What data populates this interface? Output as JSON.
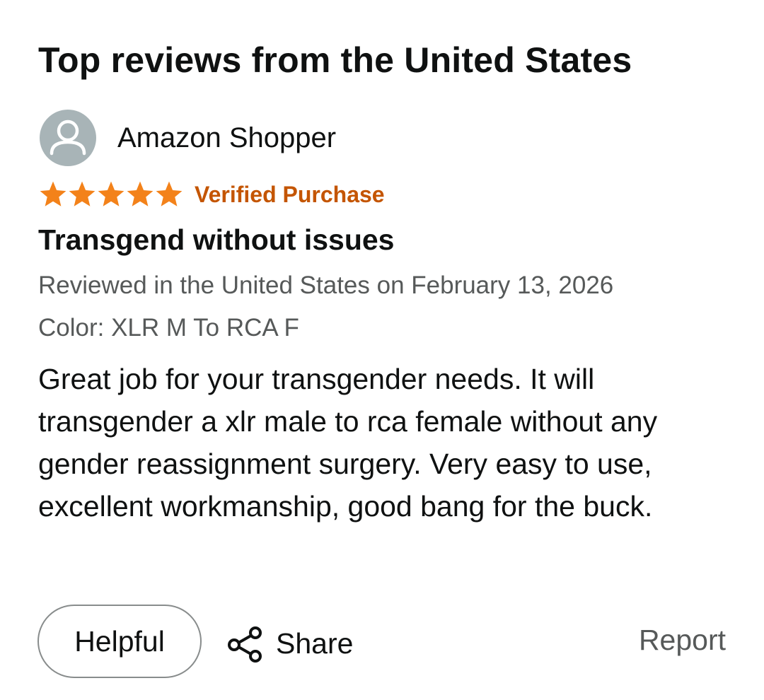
{
  "section": {
    "title": "Top reviews from the United States"
  },
  "review": {
    "reviewer": {
      "name": "Amazon Shopper",
      "avatar_icon": "user-silhouette-icon"
    },
    "rating": {
      "stars": 5,
      "max_stars": 5,
      "star_color": "#f3821a"
    },
    "verified_label": "Verified Purchase",
    "verified_color": "#c45500",
    "title": "Transgend without issues",
    "date_line": "Reviewed in the United States on February 13, 2026",
    "variant_line": "Color: XLR M To RCA F",
    "body": "Great job for your transgender needs. It will transgender a xlr male to rca female without any gender reassignment surgery. Very easy to use, excellent workmanship, good bang for the buck."
  },
  "actions": {
    "helpful_label": "Helpful",
    "share_label": "Share",
    "share_icon": "share-icon",
    "report_label": "Report"
  }
}
